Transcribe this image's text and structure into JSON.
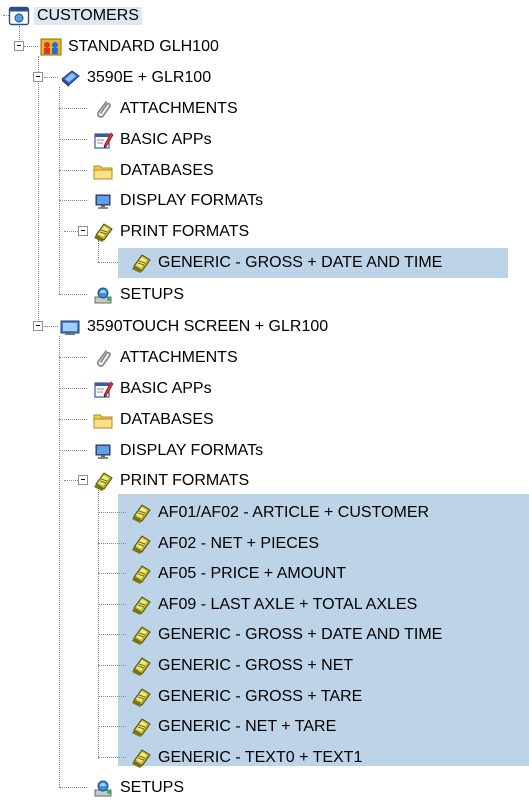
{
  "tree": {
    "root": {
      "label": "CUSTOMERS",
      "icon": "customers-folder-icon"
    },
    "customer": {
      "label": "STANDARD GLH100",
      "icon": "customer-group-icon"
    },
    "device1": {
      "label": "3590E + GLR100",
      "icon": "terminal-device-icon",
      "children": {
        "attachments": "ATTACHMENTS",
        "basic_apps": "BASIC APPs",
        "databases": "DATABASES",
        "display_formats": "DISPLAY FORMATs",
        "print_formats": "PRINT FORMATS",
        "setups": "SETUPS"
      },
      "print_items": [
        "GENERIC - GROSS + DATE AND TIME"
      ]
    },
    "device2": {
      "label": "3590TOUCH SCREEN + GLR100",
      "icon": "touchscreen-device-icon",
      "children": {
        "attachments": "ATTACHMENTS",
        "basic_apps": "BASIC APPs",
        "databases": "DATABASES",
        "display_formats": "DISPLAY FORMATs",
        "print_formats": "PRINT FORMATS",
        "setups": "SETUPS"
      },
      "print_items": [
        "AF01/AF02 - ARTICLE + CUSTOMER",
        "AF02 - NET + PIECES",
        "AF05 - PRICE + AMOUNT",
        "AF09 - LAST AXLE + TOTAL AXLES",
        "GENERIC - GROSS + DATE AND TIME",
        "GENERIC - GROSS + NET",
        "GENERIC - GROSS + TARE",
        "GENERIC - NET + TARE",
        "GENERIC - TEXT0 + TEXT1"
      ]
    }
  },
  "colors": {
    "selection": "#bdd3e8",
    "tree_line": "#888888"
  }
}
